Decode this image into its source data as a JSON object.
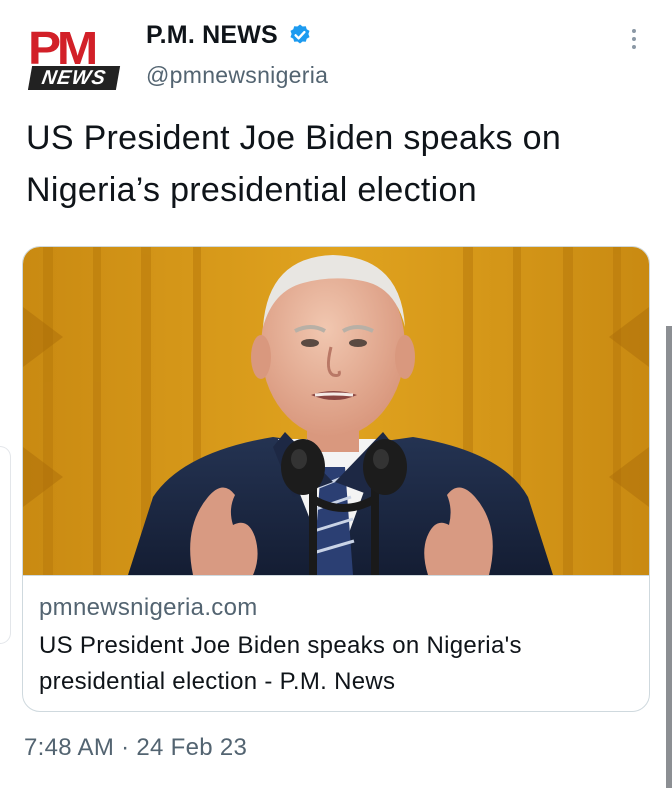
{
  "account": {
    "logo_top": "PM",
    "logo_bottom": "NEWS",
    "display_name": "P.M. NEWS",
    "handle": "@pmnewsnigeria",
    "verified": true,
    "verified_icon": "verified-badge-icon",
    "more_icon": "more-vertical-icon"
  },
  "tweet": {
    "text": "US President Joe Biden speaks on Nigeria’s presidential election",
    "timestamp": "7:48 AM · 24 Feb 23"
  },
  "card": {
    "image": "photo-joe-biden-at-podium",
    "domain": "pmnewsnigeria.com",
    "title": "US President Joe Biden speaks on Nigeria's presidential election - P.M. News"
  },
  "colors": {
    "brand_red": "#d22028",
    "verified_blue": "#1d9bf0",
    "text_primary": "#0f1419",
    "text_secondary": "#536471",
    "border": "#cfd9de"
  }
}
